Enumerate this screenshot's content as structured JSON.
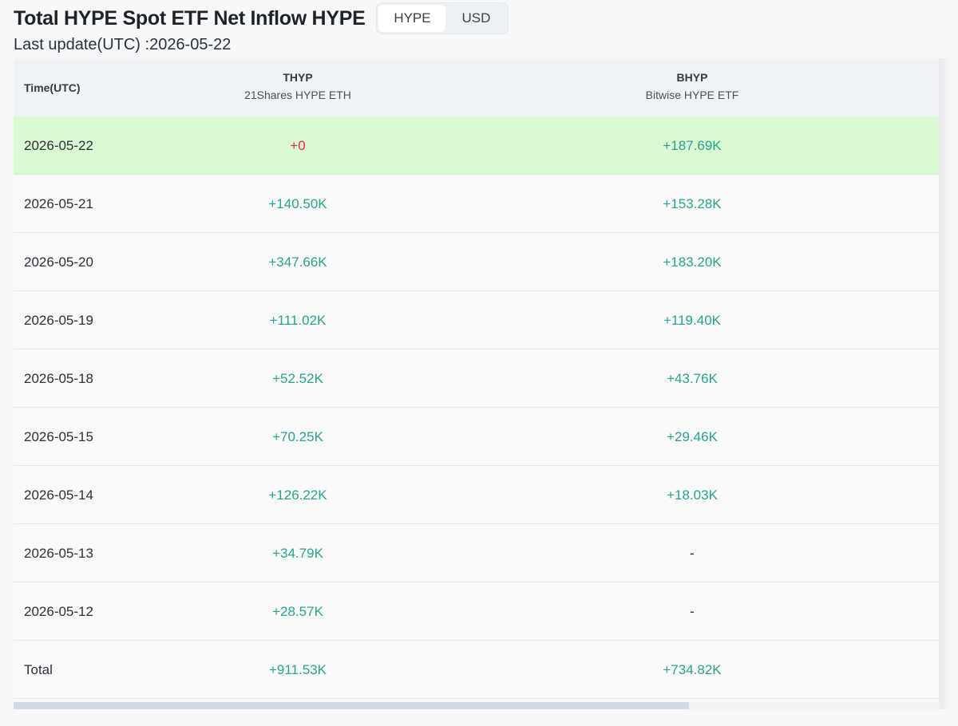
{
  "header": {
    "title": "Total HYPE Spot ETF Net Inflow HYPE",
    "toggle": {
      "options": [
        "HYPE",
        "USD"
      ],
      "selected": "HYPE"
    },
    "last_update": "Last update(UTC) :2026-05-22"
  },
  "table": {
    "columns": {
      "time": "Time(UTC)",
      "col1": {
        "ticker": "THYP",
        "fund": "21Shares HYPE ETH"
      },
      "col2": {
        "ticker": "BHYP",
        "fund": "Bitwise HYPE ETF"
      }
    },
    "rows": [
      {
        "date": "2026-05-22",
        "thyp": "+0",
        "bhyp": "+187.69K"
      },
      {
        "date": "2026-05-21",
        "thyp": "+140.50K",
        "bhyp": "+153.28K"
      },
      {
        "date": "2026-05-20",
        "thyp": "+347.66K",
        "bhyp": "+183.20K"
      },
      {
        "date": "2026-05-19",
        "thyp": "+111.02K",
        "bhyp": "+119.40K"
      },
      {
        "date": "2026-05-18",
        "thyp": "+52.52K",
        "bhyp": "+43.76K"
      },
      {
        "date": "2026-05-15",
        "thyp": "+70.25K",
        "bhyp": "+29.46K"
      },
      {
        "date": "2026-05-14",
        "thyp": "+126.22K",
        "bhyp": "+18.03K"
      },
      {
        "date": "2026-05-13",
        "thyp": "+34.79K",
        "bhyp": "-"
      },
      {
        "date": "2026-05-12",
        "thyp": "+28.57K",
        "bhyp": "-"
      },
      {
        "date": "Total",
        "thyp": "+911.53K",
        "bhyp": "+734.82K"
      }
    ]
  },
  "colors": {
    "positive": "#2aa28d",
    "zero": "#e0303a",
    "highlight_row": "#dafad3",
    "header_bg": "#eff3f7"
  }
}
